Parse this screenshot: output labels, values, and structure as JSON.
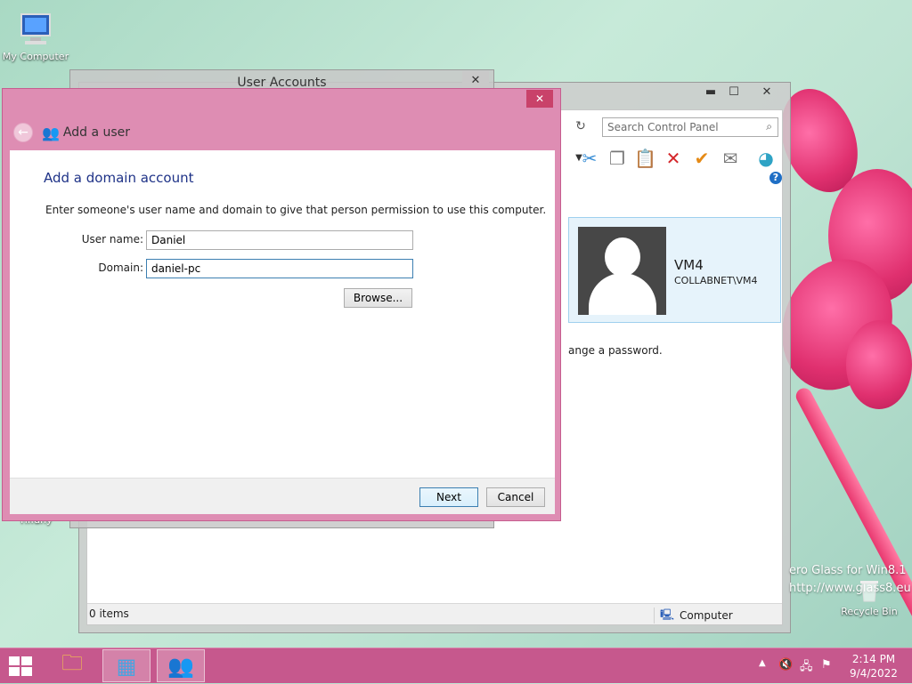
{
  "desktop": {
    "icons": {
      "my_computer": "My Computer",
      "partial_label": "Tiffany",
      "recycle_bin": "Recycle Bin"
    },
    "watermark": {
      "line1": "ero Glass for Win8.1",
      "line2": "http://www.glass8.eu"
    }
  },
  "control_panel": {
    "search_placeholder": "Search Control Panel",
    "user_tile": {
      "name": "VM4",
      "account": "COLLABNET\\VM4"
    },
    "password_text": "ange a password.",
    "status": {
      "items": "0 items",
      "location": "Computer"
    },
    "controls": {
      "minimize": "▬",
      "maximize": "☐",
      "close": "✕"
    }
  },
  "user_accounts_window": {
    "title": "User Accounts",
    "close": "✕"
  },
  "dialog": {
    "header": "Add a user",
    "heading": "Add a domain account",
    "description": "Enter someone's user name and domain to give that person permission to use this computer.",
    "username_label": "User name:",
    "username_value": "Daniel",
    "domain_label": "Domain:",
    "domain_value": "daniel-pc",
    "browse_label": "Browse...",
    "next_label": "Next",
    "cancel_label": "Cancel",
    "close": "✕"
  },
  "taskbar": {
    "clock_time": "2:14 PM",
    "clock_date": "9/4/2022"
  },
  "colors": {
    "accent": "#c6588d",
    "dialog_frame": "#de8db3",
    "heading_blue": "#1e3287"
  }
}
